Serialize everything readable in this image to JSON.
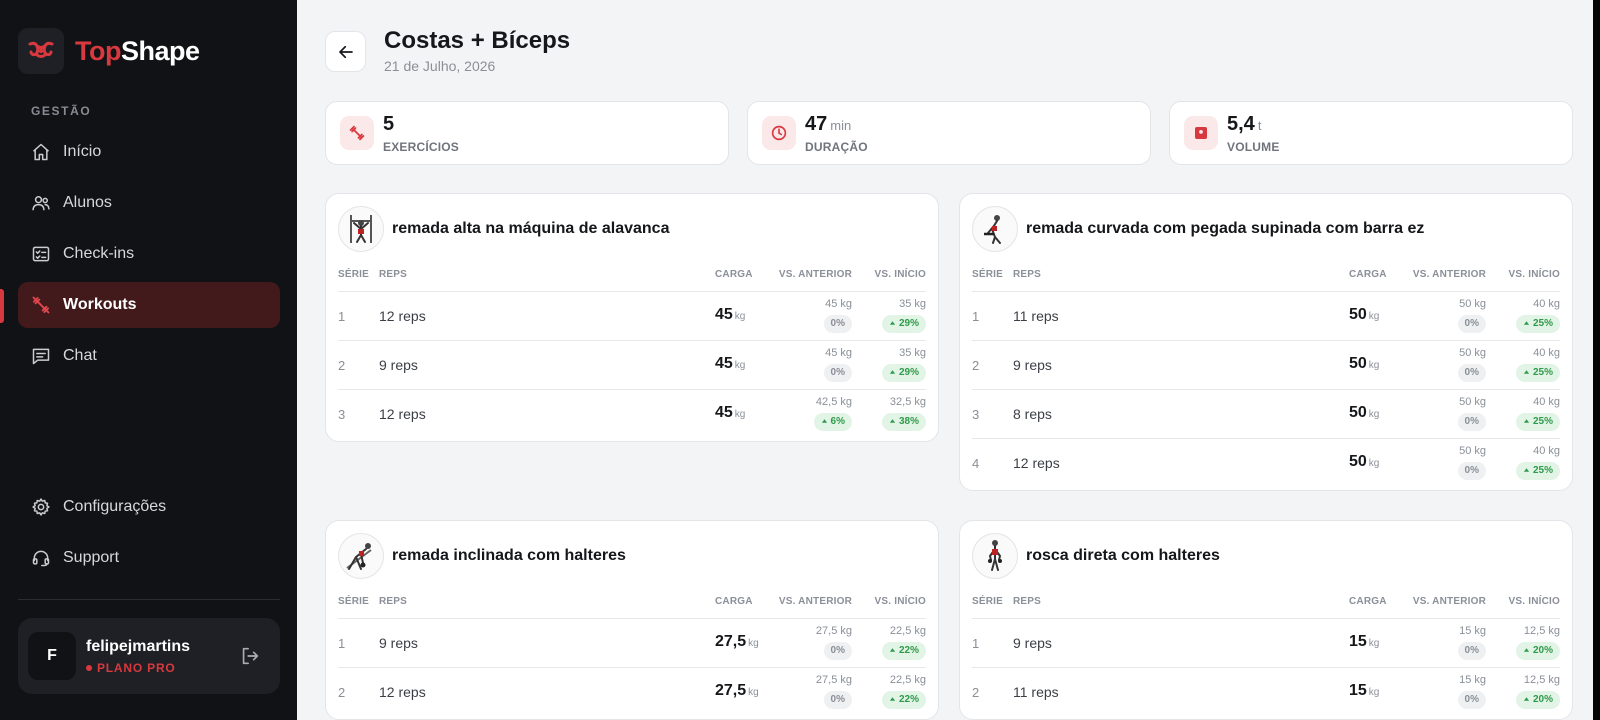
{
  "app": {
    "brand_part1": "Top",
    "brand_part2": "Shape"
  },
  "colors": {
    "accent": "#d8393f",
    "sidebar_bg": "#111215",
    "positive": "#2f9a4a"
  },
  "sidebar": {
    "section_label": "GESTÃO",
    "items": [
      {
        "label": "Início",
        "icon": "home-icon"
      },
      {
        "label": "Alunos",
        "icon": "users-icon"
      },
      {
        "label": "Check-ins",
        "icon": "checklist-icon"
      },
      {
        "label": "Workouts",
        "icon": "dumbbell-icon",
        "active": true
      },
      {
        "label": "Chat",
        "icon": "chat-icon"
      }
    ],
    "bottom_items": [
      {
        "label": "Configurações",
        "icon": "gear-icon"
      },
      {
        "label": "Support",
        "icon": "headset-icon"
      }
    ],
    "user": {
      "initial": "F",
      "name": "felipejmartins",
      "plan": "PLANO PRO"
    }
  },
  "header": {
    "title": "Costas + Bíceps",
    "date": "21 de Julho, 2026"
  },
  "stats": [
    {
      "value": "5",
      "unit": "",
      "label": "EXERCÍCIOS",
      "icon": "dumbbell-icon"
    },
    {
      "value": "47",
      "unit": "min",
      "label": "DURAÇÃO",
      "icon": "clock-icon"
    },
    {
      "value": "5,4",
      "unit": "t",
      "label": "VOLUME",
      "icon": "weight-icon"
    }
  ],
  "table_headers": {
    "serie": "SÉRIE",
    "reps": "REPS",
    "carga": "CARGA",
    "vs_anterior": "VS. ANTERIOR",
    "vs_inicio": "VS. INÍCIO"
  },
  "kg_unit": "kg",
  "exercises": [
    {
      "name": "remada alta na máquina de alavanca",
      "sets": [
        {
          "serie": "1",
          "reps": "12 reps",
          "carga": "45",
          "prev": "45 kg",
          "prev_delta": "0%",
          "prev_trend": "neutral",
          "start": "35 kg",
          "start_delta": "29%",
          "start_trend": "up"
        },
        {
          "serie": "2",
          "reps": "9 reps",
          "carga": "45",
          "prev": "45 kg",
          "prev_delta": "0%",
          "prev_trend": "neutral",
          "start": "35 kg",
          "start_delta": "29%",
          "start_trend": "up"
        },
        {
          "serie": "3",
          "reps": "12 reps",
          "carga": "45",
          "prev": "42,5 kg",
          "prev_delta": "6%",
          "prev_trend": "up",
          "start": "32,5 kg",
          "start_delta": "38%",
          "start_trend": "up"
        }
      ]
    },
    {
      "name": "remada curvada com pegada supinada com barra ez",
      "sets": [
        {
          "serie": "1",
          "reps": "11 reps",
          "carga": "50",
          "prev": "50 kg",
          "prev_delta": "0%",
          "prev_trend": "neutral",
          "start": "40 kg",
          "start_delta": "25%",
          "start_trend": "up"
        },
        {
          "serie": "2",
          "reps": "9 reps",
          "carga": "50",
          "prev": "50 kg",
          "prev_delta": "0%",
          "prev_trend": "neutral",
          "start": "40 kg",
          "start_delta": "25%",
          "start_trend": "up"
        },
        {
          "serie": "3",
          "reps": "8 reps",
          "carga": "50",
          "prev": "50 kg",
          "prev_delta": "0%",
          "prev_trend": "neutral",
          "start": "40 kg",
          "start_delta": "25%",
          "start_trend": "up"
        },
        {
          "serie": "4",
          "reps": "12 reps",
          "carga": "50",
          "prev": "50 kg",
          "prev_delta": "0%",
          "prev_trend": "neutral",
          "start": "40 kg",
          "start_delta": "25%",
          "start_trend": "up"
        }
      ]
    },
    {
      "name": "remada inclinada com halteres",
      "sets": [
        {
          "serie": "1",
          "reps": "9 reps",
          "carga": "27,5",
          "prev": "27,5 kg",
          "prev_delta": "0%",
          "prev_trend": "neutral",
          "start": "22,5 kg",
          "start_delta": "22%",
          "start_trend": "up"
        },
        {
          "serie": "2",
          "reps": "12 reps",
          "carga": "27,5",
          "prev": "27,5 kg",
          "prev_delta": "0%",
          "prev_trend": "neutral",
          "start": "22,5 kg",
          "start_delta": "22%",
          "start_trend": "up"
        }
      ]
    },
    {
      "name": "rosca direta com halteres",
      "sets": [
        {
          "serie": "1",
          "reps": "9 reps",
          "carga": "15",
          "prev": "15 kg",
          "prev_delta": "0%",
          "prev_trend": "neutral",
          "start": "12,5 kg",
          "start_delta": "20%",
          "start_trend": "up"
        },
        {
          "serie": "2",
          "reps": "11 reps",
          "carga": "15",
          "prev": "15 kg",
          "prev_delta": "0%",
          "prev_trend": "neutral",
          "start": "12,5 kg",
          "start_delta": "20%",
          "start_trend": "up"
        }
      ]
    }
  ]
}
